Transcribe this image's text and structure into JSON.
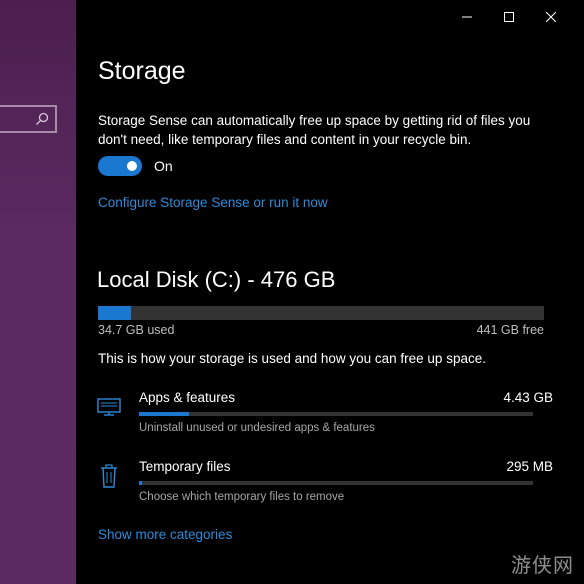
{
  "sidebar": {
    "search_icon": "search-icon"
  },
  "window": {
    "controls": [
      "minimize",
      "maximize",
      "close"
    ]
  },
  "page": {
    "title": "Storage",
    "description": "Storage Sense can automatically free up space by getting rid of files you don't need, like temporary files and content in your recycle bin.",
    "toggle_state": "On",
    "configure_link": "Configure Storage Sense or run it now"
  },
  "disk": {
    "title": "Local Disk (C:) - 476 GB",
    "used_label": "34.7 GB used",
    "free_label": "441 GB free",
    "used_fraction": 0.073
  },
  "usage": {
    "intro": "This is how your storage is used and how you can free up space.",
    "categories": [
      {
        "name": "Apps & features",
        "size": "4.43 GB",
        "subtitle": "Uninstall unused or undesired apps & features",
        "fraction": 0.128,
        "icon": "monitor-icon"
      },
      {
        "name": "Temporary files",
        "size": "295 MB",
        "subtitle": "Choose which temporary files to remove",
        "fraction": 0.008,
        "icon": "trash-icon"
      }
    ],
    "more_link": "Show more categories"
  },
  "watermark": "游侠网",
  "colors": {
    "accent": "#1a78d0",
    "link": "#2f8ad9",
    "background": "#000000",
    "sidebar": "#5a2a60"
  }
}
